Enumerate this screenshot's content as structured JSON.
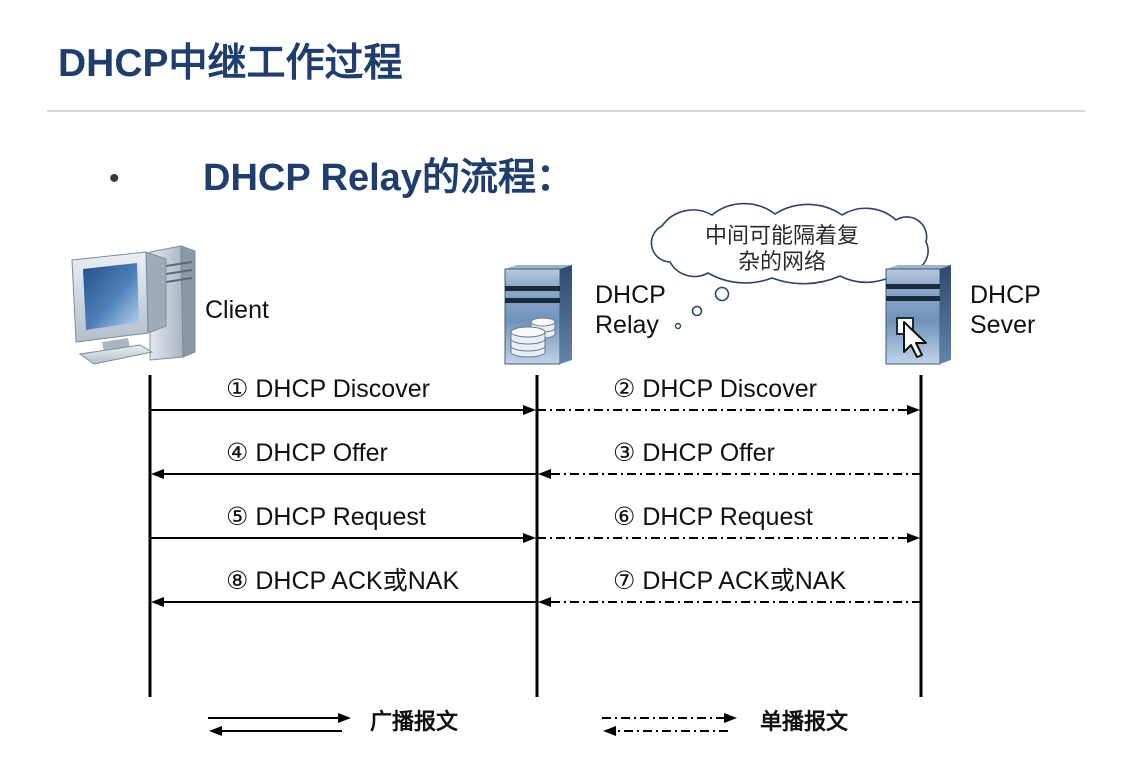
{
  "title": "DHCP中继工作过程",
  "section": {
    "bullet": "•",
    "heading": "DHCP Relay的流程："
  },
  "cloud": {
    "lines": [
      "中间可能隔着复",
      "杂的网络"
    ]
  },
  "nodes": [
    {
      "icon": "desktop-computer-icon",
      "lines": [
        "Client"
      ]
    },
    {
      "icon": "relay-server-icon",
      "lines": [
        "DHCP",
        "Relay"
      ]
    },
    {
      "icon": "dhcp-server-icon",
      "lines": [
        "DHCP",
        "Sever"
      ]
    }
  ],
  "steps": [
    [
      {
        "label": "① DHCP Discover",
        "from": 0,
        "to": 1,
        "dashed": false
      },
      {
        "label": "② DHCP Discover",
        "from": 1,
        "to": 2,
        "dashed": true
      }
    ],
    [
      {
        "label": "④ DHCP Offer",
        "from": 1,
        "to": 0,
        "dashed": false
      },
      {
        "label": "③ DHCP Offer",
        "from": 2,
        "to": 1,
        "dashed": true
      }
    ],
    [
      {
        "label": "⑤ DHCP Request",
        "from": 0,
        "to": 1,
        "dashed": false
      },
      {
        "label": "⑥ DHCP Request",
        "from": 1,
        "to": 2,
        "dashed": true
      }
    ],
    [
      {
        "label": "⑧ DHCP ACK或NAK",
        "from": 1,
        "to": 0,
        "dashed": false
      },
      {
        "label": "⑦ DHCP ACK或NAK",
        "from": 2,
        "to": 1,
        "dashed": true
      }
    ]
  ],
  "legend": [
    {
      "label": "广播报文",
      "dashed": false
    },
    {
      "label": "单播报文",
      "dashed": true
    }
  ],
  "colors": {
    "heading": "#1f3e6e",
    "divider": "#d6d6d6",
    "cloud_outline": "#2b4468",
    "arrow": "#000000"
  }
}
